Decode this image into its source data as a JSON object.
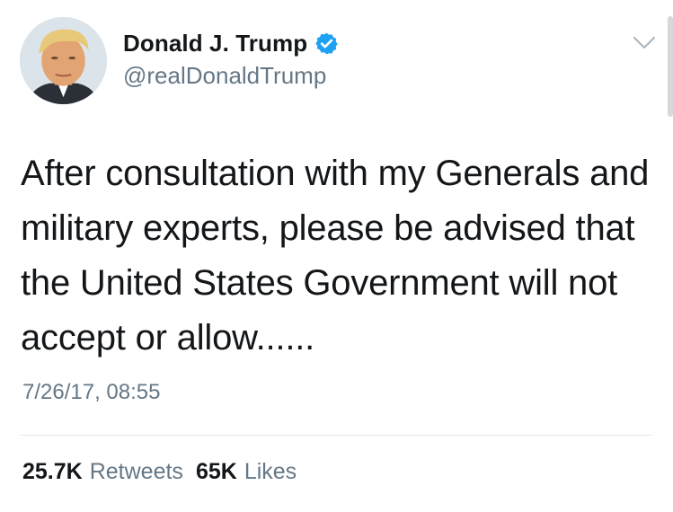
{
  "author": {
    "display_name": "Donald J. Trump",
    "handle": "@realDonaldTrump",
    "verified": true
  },
  "tweet": {
    "lines": [
      "After consultation with my Generals and",
      "military experts, please be advised that",
      "the United States Government will not",
      "accept or allow......"
    ],
    "timestamp": "7/26/17, 08:55"
  },
  "stats": {
    "retweets_count": "25.7K",
    "retweets_label": "Retweets",
    "likes_count": "65K",
    "likes_label": "Likes"
  },
  "colors": {
    "verified_badge": "#1da1f2",
    "secondary_text": "#657786",
    "primary_text": "#14171a"
  },
  "icons": {
    "verified": "verified-badge-icon",
    "menu": "chevron-down-icon"
  }
}
